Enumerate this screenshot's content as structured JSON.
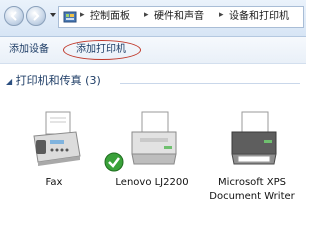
{
  "addressbar": {
    "breadcrumbs": [
      "控制面板",
      "硬件和声音",
      "设备和打印机"
    ]
  },
  "toolbar": {
    "add_device": "添加设备",
    "add_printer": "添加打印机"
  },
  "group": {
    "title": "打印机和传真 (3)"
  },
  "devices": [
    {
      "label": "Fax",
      "icon": "fax-icon"
    },
    {
      "label": "Lenovo LJ2200",
      "icon": "printer-icon",
      "default": true
    },
    {
      "label": "Microsoft XPS Document Writer",
      "icon": "xps-printer-icon"
    }
  ]
}
